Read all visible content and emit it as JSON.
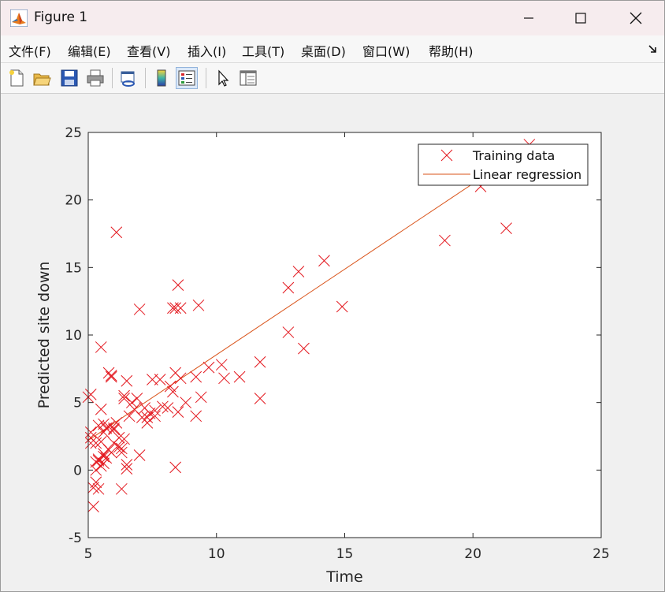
{
  "window": {
    "title": "Figure 1",
    "app_icon": "matlab-logo-icon",
    "controls": [
      "minimize-icon",
      "maximize-icon",
      "close-icon"
    ]
  },
  "menu": {
    "items": [
      "文件(F)",
      "编辑(E)",
      "查看(V)",
      "插入(I)",
      "工具(T)",
      "桌面(D)",
      "窗口(W)",
      "帮助(H)"
    ],
    "dock_icon": "dock-arrow-icon"
  },
  "toolbar": {
    "tools": [
      {
        "name": "new-figure-icon"
      },
      {
        "name": "open-file-icon"
      },
      {
        "name": "save-icon"
      },
      {
        "name": "print-icon"
      },
      {
        "name": "link-plot-icon"
      },
      {
        "name": "insert-colorbar-icon"
      },
      {
        "name": "insert-legend-icon",
        "active": true
      },
      {
        "name": "edit-plot-arrow-icon"
      },
      {
        "name": "property-inspector-icon"
      }
    ]
  },
  "chart_data": {
    "type": "scatter",
    "title": "",
    "xlabel": "Time",
    "ylabel": "Predicted site down",
    "xlim": [
      5,
      25
    ],
    "ylim": [
      -5,
      25
    ],
    "xticks": [
      "5",
      "10",
      "15",
      "20",
      "25"
    ],
    "yticks": [
      "-5",
      "0",
      "5",
      "10",
      "15",
      "20",
      "25"
    ],
    "grid": false,
    "legend_position": "top-right",
    "colors": {
      "scatter": "#e3171e",
      "line": "#d95319"
    },
    "series": [
      {
        "name": "Training data",
        "marker": "x",
        "x": [
          6.1,
          5.5,
          8.5,
          7.0,
          5.9,
          8.4,
          5.8,
          8.4,
          6.5,
          5.1,
          6.0,
          5.5,
          5.1,
          5.1,
          5.3,
          6.4,
          5.6,
          5.7,
          6.3,
          5.3,
          6.5,
          5.0,
          6.0,
          5.6,
          5.4,
          5.6,
          7.1,
          9.3,
          8.3,
          14.2,
          13.2,
          12.8,
          12.8,
          13.4,
          8.6,
          9.2,
          5.1,
          5.4,
          5.6,
          5.4,
          20.3,
          21.3,
          22.2,
          18.9,
          14.9,
          11.7,
          11.7,
          10.2,
          10.3,
          9.7,
          9.2,
          9.4,
          7.2,
          7.3,
          7.6,
          7.5,
          7.8,
          8.1,
          8.3,
          8.6,
          6.3,
          6.5,
          6.4,
          6.2,
          6.0,
          5.9,
          5.8,
          5.7,
          5.6,
          5.5,
          5.4,
          5.3,
          5.2,
          6.8,
          6.9,
          7.0,
          7.4,
          7.6,
          7.9,
          8.2,
          8.4,
          8.5,
          6.1,
          6.7,
          6.4,
          5.9,
          5.2,
          5.5,
          6.6,
          7.3,
          5.8,
          6.2,
          5.3,
          10.9,
          8.8,
          6.3
        ],
        "y": [
          17.6,
          9.1,
          13.7,
          11.9,
          7.0,
          12.0,
          1.5,
          0.2,
          0.1,
          5.6,
          3.0,
          4.5,
          2.8,
          2.4,
          0.0,
          5.3,
          3.4,
          3.1,
          1.3,
          0.6,
          6.6,
          5.4,
          3.1,
          2.8,
          -1.4,
          1.0,
          3.9,
          12.2,
          12.0,
          15.5,
          14.7,
          13.5,
          10.2,
          9.0,
          12.0,
          6.9,
          2.0,
          0.8,
          1.2,
          3.3,
          21.0,
          17.9,
          24.1,
          17.0,
          12.1,
          8.0,
          5.3,
          7.8,
          6.8,
          7.6,
          4.0,
          5.4,
          4.6,
          3.5,
          4.0,
          6.7,
          6.7,
          4.6,
          5.8,
          6.8,
          -1.4,
          0.4,
          2.3,
          1.7,
          2.0,
          6.9,
          7.2,
          0.9,
          0.5,
          2.1,
          0.7,
          -0.9,
          -1.3,
          4.5,
          5.3,
          1.1,
          4.2,
          4.4,
          4.7,
          6.2,
          7.2,
          4.3,
          3.5,
          5.0,
          5.5,
          1.3,
          -2.7,
          0.3,
          4.0,
          3.9,
          3.2,
          2.4,
          2.0,
          6.9,
          5.0,
          1.6
        ]
      },
      {
        "name": "Linear regression",
        "marker": "line",
        "x": [
          5.0,
          22.2
        ],
        "y": [
          2.2,
          24.0
        ]
      }
    ]
  }
}
